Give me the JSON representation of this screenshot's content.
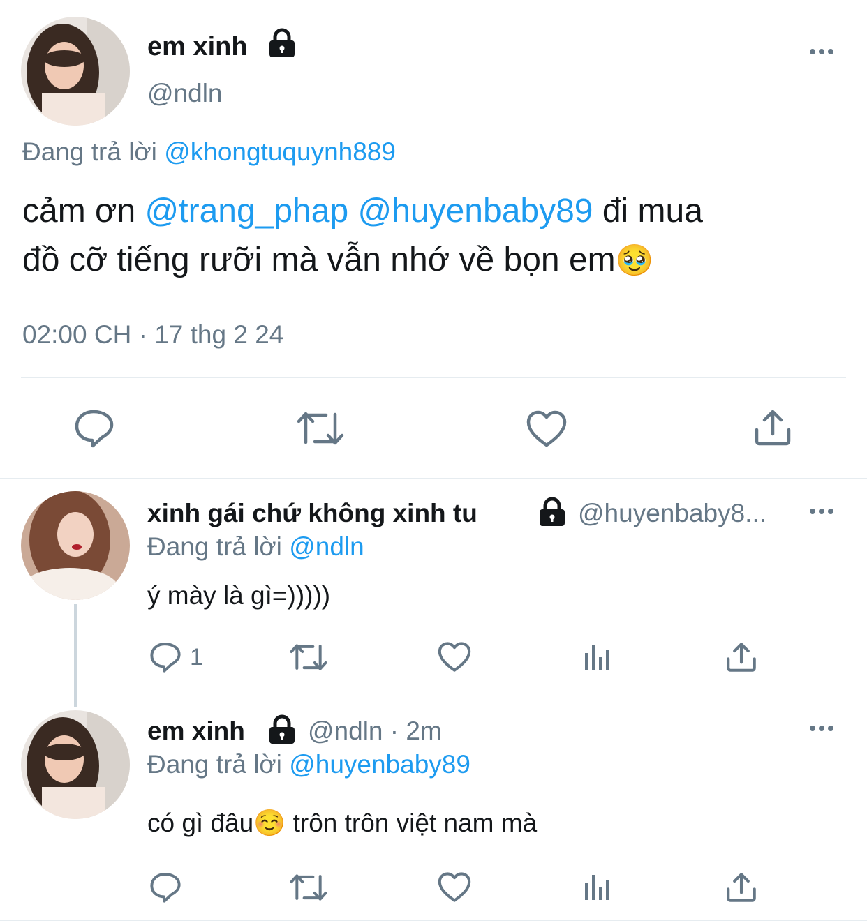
{
  "main_tweet": {
    "display_name": "em xinh",
    "handle": "@ndln",
    "reply_prefix": "Đang trả lời",
    "reply_to": "@khongtuquynh889",
    "text_part1": "cảm ơn",
    "mention1": "@trang_phap",
    "mention2": "@huyenbaby89",
    "text_part2": "đi mua",
    "text_line2": "đồ cỡ tiếng rưỡi mà vẫn nhớ về bọn em",
    "emoji": "🥹",
    "timestamp": "02:00 CH · 17 thg 2 24"
  },
  "reply1": {
    "display_name": "xinh gái chứ không xinh tu",
    "handle": "@huyenbaby8...",
    "reply_prefix": "Đang trả lời",
    "reply_to": "@ndln",
    "text": "ý mày là gì=)))))",
    "reply_count": "1"
  },
  "reply2": {
    "display_name": "em xinh",
    "handle_time": "@ndln · 2m",
    "reply_prefix": "Đang trả lời",
    "reply_to": "@huyenbaby89",
    "text_a": "có gì đâu",
    "emoji": "☺️",
    "text_b": "trôn trôn việt nam mà"
  },
  "colors": {
    "link": "#1d9bf0",
    "secondary": "#657786",
    "primary": "#14171a",
    "divider": "#e6ecf0"
  },
  "icons": [
    "lock-icon",
    "more-icon",
    "reply-icon",
    "retweet-icon",
    "like-icon",
    "share-icon",
    "analytics-icon"
  ]
}
